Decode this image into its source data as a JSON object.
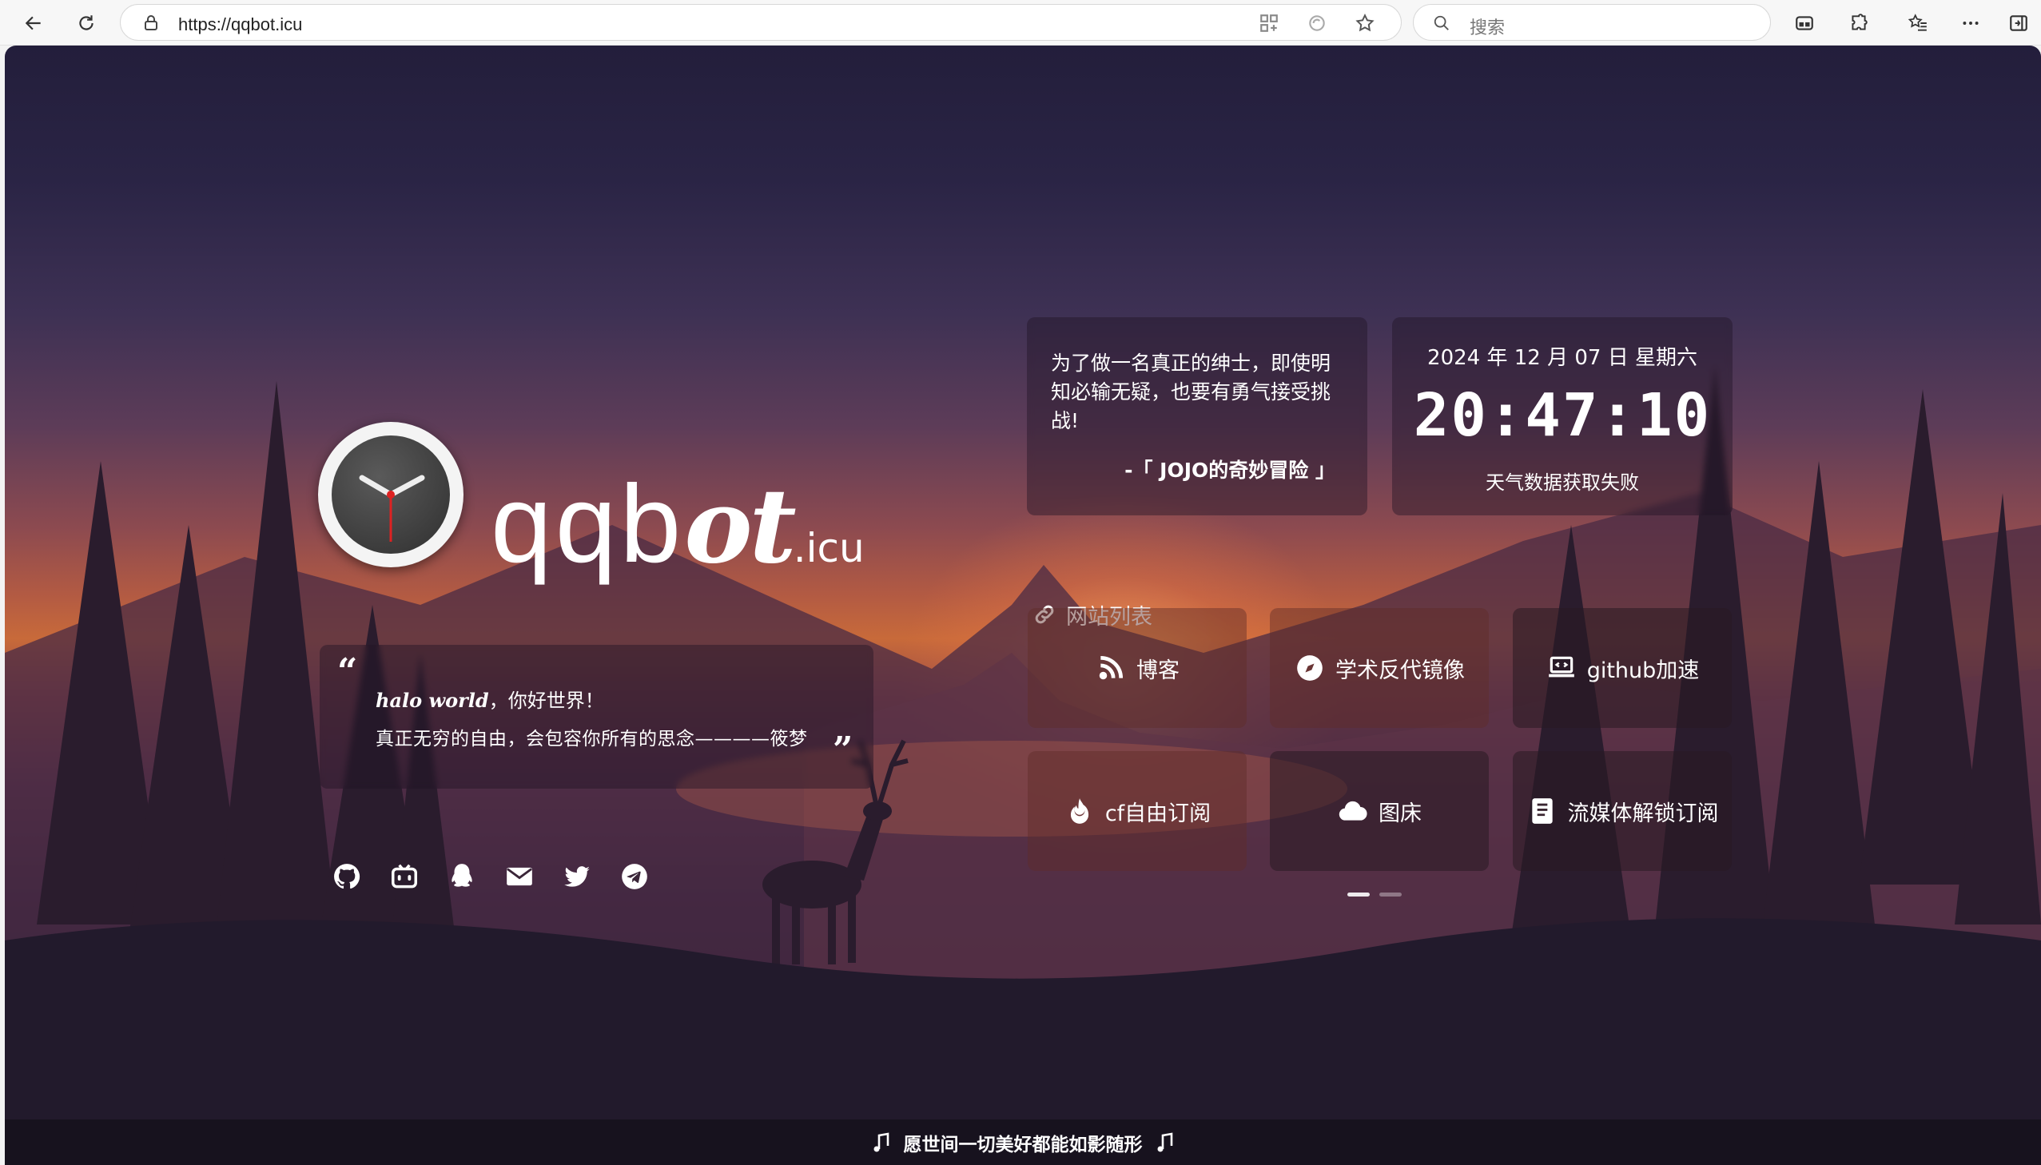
{
  "browser": {
    "url": "https://qqbot.icu",
    "search_placeholder": "搜索"
  },
  "brand": {
    "name_main": "qqb",
    "name_script": "ot",
    "name_suffix": ".icu"
  },
  "intro": {
    "hello": "halo world",
    "greeting": "，你好世界！",
    "motto": "真正无穷的自由，会包容你所有的思念————筱梦"
  },
  "social": [
    "github-icon",
    "bilibili-icon",
    "qq-icon",
    "mail-icon",
    "twitter-icon",
    "telegram-icon"
  ],
  "hitokoto": {
    "text": "为了做一名真正的绅士，即使明知必输无疑，也要有勇气接受挑战!",
    "from": "-「 JOJO的奇妙冒险 」"
  },
  "time": {
    "date": "2024 年 12 月 07 日 星期六",
    "clock": "20:47:10",
    "weather": "天气数据获取失败"
  },
  "sites": {
    "title": "网站列表",
    "items": [
      {
        "label": "博客",
        "icon": "blog-icon"
      },
      {
        "label": "学术反代镜像",
        "icon": "compass-icon"
      },
      {
        "label": "github加速",
        "icon": "laptop-code-icon"
      },
      {
        "label": "cf自由订阅",
        "icon": "fire-icon"
      },
      {
        "label": "图床",
        "icon": "cloud-icon"
      },
      {
        "label": "流媒体解锁订阅",
        "icon": "book-icon"
      }
    ]
  },
  "footer": {
    "music_text": "愿世间一切美好都能如影随形"
  },
  "colors": {
    "accent_sunset": "#c86a3a",
    "sky_top": "#231e3b"
  }
}
